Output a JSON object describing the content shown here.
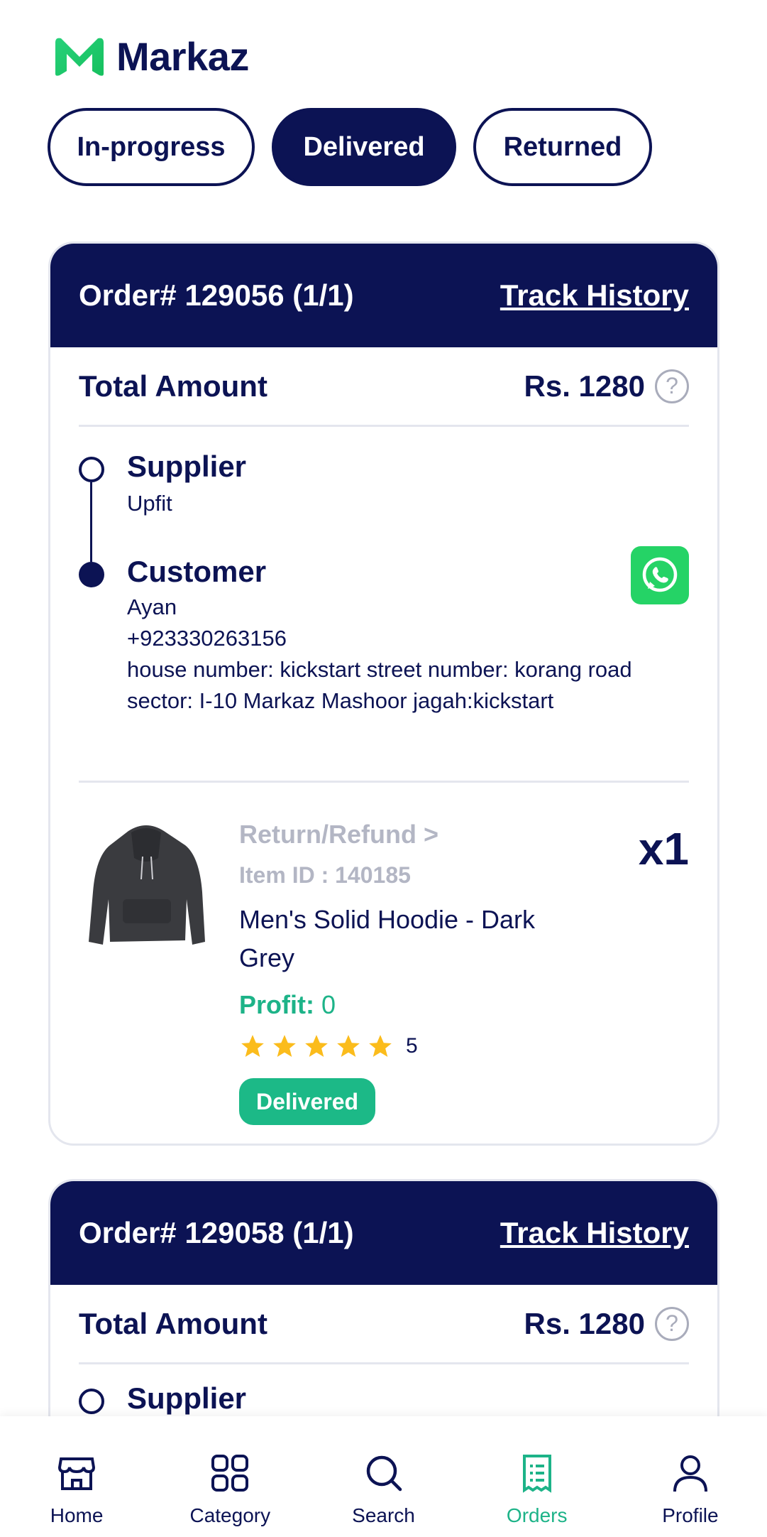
{
  "app": {
    "name": "Markaz"
  },
  "tabs": [
    {
      "label": "In-progress",
      "active": false
    },
    {
      "label": "Delivered",
      "active": true
    },
    {
      "label": "Returned",
      "active": false
    }
  ],
  "orders": [
    {
      "order_no": "Order# 129056 (1/1)",
      "track_label": "Track History",
      "total_label": "Total Amount",
      "total_amount": "Rs. 1280",
      "supplier_title": "Supplier",
      "supplier_name": "Upfit",
      "customer_title": "Customer",
      "customer_name": "Ayan",
      "customer_phone": "+923330263156",
      "customer_address": "house number: kickstart street number: korang road  sector: I-10 Markaz Mashoor jagah:kickstart",
      "item": {
        "return_label": "Return/Refund >",
        "item_id": "Item ID : 140185",
        "name": "Men's Solid Hoodie - Dark Grey",
        "profit_label": "Profit:",
        "profit_value": " 0",
        "rating": 5,
        "rating_label": "5",
        "status": "Delivered",
        "qty": "x1"
      }
    },
    {
      "order_no": "Order# 129058 (1/1)",
      "track_label": "Track History",
      "total_label": "Total Amount",
      "total_amount": "Rs. 1280",
      "supplier_title": "Supplier"
    }
  ],
  "nav": [
    {
      "label": "Home",
      "icon": "store-icon"
    },
    {
      "label": "Category",
      "icon": "grid-icon"
    },
    {
      "label": "Search",
      "icon": "search-icon"
    },
    {
      "label": "Orders",
      "icon": "orders-icon",
      "active": true
    },
    {
      "label": "Profile",
      "icon": "user-icon"
    }
  ],
  "colors": {
    "navy": "#0c1354",
    "green": "#1db388",
    "whatsapp": "#25d366",
    "star": "#fbbc1c"
  }
}
